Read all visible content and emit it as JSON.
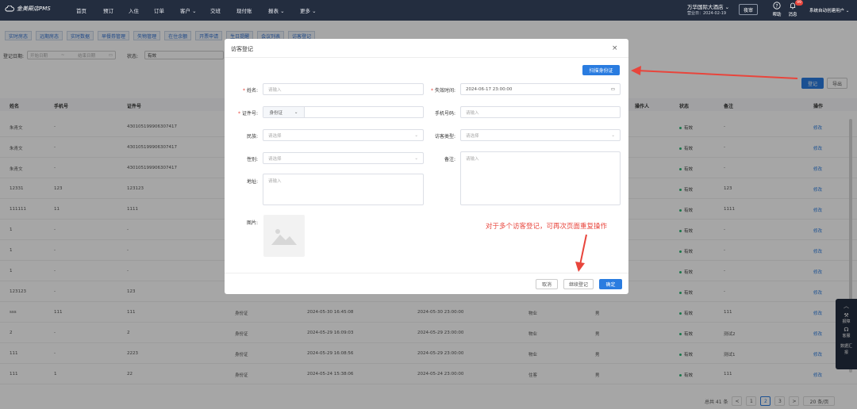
{
  "nav": {
    "logo": "金美殿店PMS",
    "items": [
      "首页",
      "预订",
      "入住",
      "订单",
      "客户",
      "交班",
      "现付账",
      "报表",
      "更多"
    ],
    "hotel": "万华国际大酒店",
    "biz_date": "营业日：2024-02-19",
    "night_audit": "夜审",
    "help": "帮助",
    "messages": "消息",
    "badge": "99",
    "user": "系统自动创建用户"
  },
  "tabs": [
    "实时房态",
    "远期房态",
    "实时数据",
    "早餐券管理",
    "失物管理",
    "在住余额",
    "开票申请",
    "生日提醒",
    "会议列表",
    "访客登记"
  ],
  "filter": {
    "reg_date_label": "登记日期:",
    "start_placeholder": "开始日期",
    "range_sep": "~",
    "end_placeholder": "结束日期",
    "status_label": "状态:",
    "status_value": "有效",
    "register_btn": "登记",
    "export_btn": "导出"
  },
  "table": {
    "headers": [
      "姓名",
      "手机号",
      "证件号",
      "",
      "",
      "",
      "",
      "",
      "操作人",
      "状态",
      "备注",
      "操作"
    ],
    "rows": [
      [
        "朱青文",
        "-",
        "430105199906307417",
        "",
        "",
        "",
        "",
        "-",
        "有效",
        "-"
      ],
      [
        "朱青文",
        "-",
        "430105199906307417",
        "",
        "",
        "",
        "",
        "-",
        "有效",
        "-"
      ],
      [
        "朱青文",
        "-",
        "430105199906307417",
        "",
        "",
        "",
        "",
        "-",
        "有效",
        "-"
      ],
      [
        "12331",
        "123",
        "123123",
        "",
        "",
        "",
        "",
        "-",
        "有效",
        "123"
      ],
      [
        "111111",
        "11",
        "1111",
        "",
        "",
        "",
        "",
        "-",
        "有效",
        "1111"
      ],
      [
        "1",
        "-",
        "-",
        "",
        "",
        "",
        "",
        "-",
        "有效",
        "-"
      ],
      [
        "1",
        "-",
        "-",
        "",
        "",
        "",
        "",
        "-",
        "有效",
        "-"
      ],
      [
        "1",
        "-",
        "-",
        "",
        "",
        "",
        "",
        "-",
        "有效",
        "-"
      ],
      [
        "123123",
        "-",
        "123",
        "",
        "2024-05-30 16:52:27",
        "2024-05-30 23:00:00",
        "",
        "-",
        "有效",
        "-"
      ],
      [
        "sss",
        "111",
        "111",
        "身份证",
        "2024-05-30 16:45:08",
        "2024-05-30 23:00:00",
        "物业",
        "男",
        "有效",
        "111"
      ],
      [
        "2",
        "-",
        "2",
        "身份证",
        "2024-05-29 16:09:03",
        "2024-05-29 23:00:00",
        "物业",
        "男",
        "有效",
        "测试2"
      ],
      [
        "111",
        "-",
        "2223",
        "身份证",
        "2024-05-29 16:08:56",
        "2024-05-29 23:00:00",
        "物业",
        "男",
        "有效",
        "测试1"
      ],
      [
        "111",
        "1",
        "22",
        "身份证",
        "2024-05-24 15:38:06",
        "2024-05-24 23:00:00",
        "住客",
        "男",
        "有效",
        "111"
      ]
    ],
    "edit_label": "修改"
  },
  "modal": {
    "title": "访客登记",
    "close": "×",
    "scan_btn": "扫描身份证",
    "name_label": "姓名:",
    "name_placeholder": "请输入",
    "expire_label": "失效时间:",
    "expire_value": "2024-06-17 23:00:00",
    "id_label": "证件号:",
    "id_type": "身份证",
    "phone_label": "手机号码:",
    "phone_placeholder": "请输入",
    "ethnic_label": "民族:",
    "ethnic_placeholder": "请选择",
    "visitor_type_label": "访客类型:",
    "visitor_type_placeholder": "请选择",
    "gender_label": "性别:",
    "gender_placeholder": "请选择",
    "remark_label": "备注:",
    "remark_placeholder": "请输入",
    "address_label": "地址:",
    "address_placeholder": "请输入",
    "photo_label": "图片:",
    "cancel_btn": "取消",
    "continue_btn": "继续登记",
    "confirm_btn": "确定"
  },
  "annotation": "对于多个访客登记，可再次页面重复操作",
  "side": {
    "report": "报障",
    "service": "客服",
    "data": "数据汇报"
  },
  "pager": {
    "total": "总共 41 条",
    "prev": "<",
    "pages": [
      "1",
      "2",
      "3"
    ],
    "next": ">",
    "page_size": "20 条/页"
  },
  "watermark": "大数跨境",
  "colors": {
    "nav_bg": "#232d3f",
    "primary": "#2a7ce0",
    "status_ok": "#2bb673",
    "annotation": "#e8453c"
  }
}
